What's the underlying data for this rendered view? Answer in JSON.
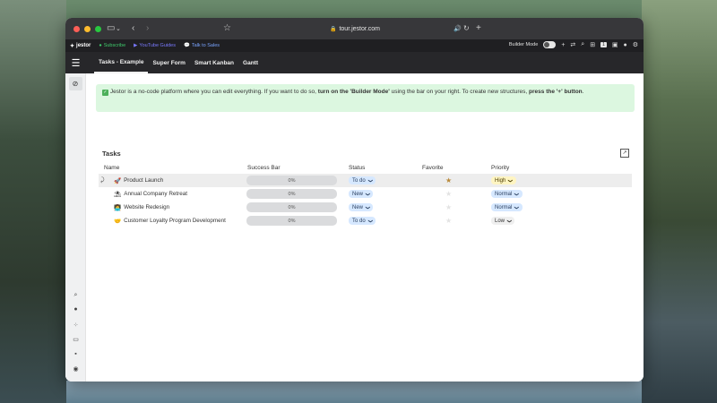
{
  "browser": {
    "url": "tour.jestor.com"
  },
  "bookmarks": {
    "logo": "jestor",
    "items": [
      {
        "label": "Subscribe",
        "icon": "circle-icon"
      },
      {
        "label": "YouTube Guides",
        "icon": "youtube-icon"
      },
      {
        "label": "Talk to Sales",
        "icon": "chat-icon"
      }
    ],
    "builder_mode_label": "Builder Mode",
    "badge": "1"
  },
  "app_nav": {
    "tabs": [
      "Tasks - Example",
      "Super Form",
      "Smart Kanban",
      "Gantt"
    ],
    "active_tab": "Tasks - Example"
  },
  "banner": {
    "text_1": "Jestor is a no-code platform where you can edit everything. If you want to do so, ",
    "bold_1": "turn on the 'Builder Mode'",
    "text_2": " using the bar on your right. To create new structures, ",
    "bold_2": "press the '+' button",
    "text_3": "."
  },
  "section": {
    "title": "Tasks"
  },
  "table": {
    "columns": [
      "Name",
      "Success Bar",
      "Status",
      "Favorite",
      "Priority"
    ],
    "rows": [
      {
        "emoji": "🚀",
        "name": "Product Launch",
        "success": "0%",
        "success_value": 0,
        "status": "To do",
        "favorite": true,
        "priority": "High"
      },
      {
        "emoji": "⛱",
        "name": "Annual Company Retreat",
        "success": "0%",
        "success_value": 0,
        "status": "New",
        "favorite": false,
        "priority": "Normal"
      },
      {
        "emoji": "👩‍💻",
        "name": "Website Redesign",
        "success": "0%",
        "success_value": 0,
        "status": "New",
        "favorite": false,
        "priority": "Normal"
      },
      {
        "emoji": "🤝",
        "name": "Customer Loyalty Program Development",
        "success": "0%",
        "success_value": 0,
        "status": "To do",
        "favorite": false,
        "priority": "Low"
      }
    ]
  },
  "colors": {
    "banner_bg": "#dcf7e0",
    "status_chip": "#d6e8ff",
    "priority_high": "#fff5c2",
    "priority_low": "#efefef",
    "star_active": "#b8893a"
  }
}
